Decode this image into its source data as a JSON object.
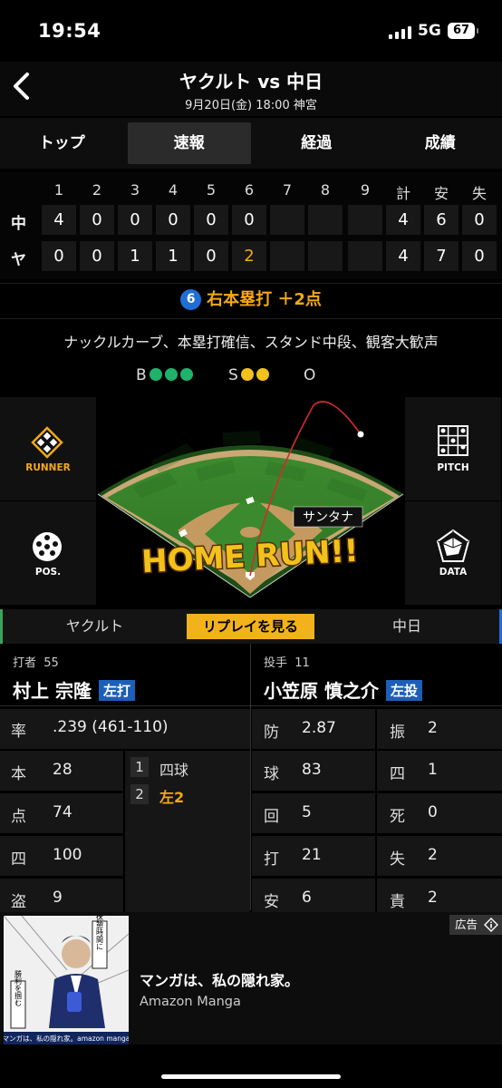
{
  "status": {
    "time": "19:54",
    "network": "5G",
    "battery": "67"
  },
  "header": {
    "title": "ヤクルト vs 中日",
    "subtitle": "9月20日(金) 18:00 神宮"
  },
  "tabs": [
    "トップ",
    "速報",
    "経過",
    "成績"
  ],
  "scoreboard": {
    "innings": [
      "1",
      "2",
      "3",
      "4",
      "5",
      "6",
      "7",
      "8",
      "9"
    ],
    "totals_headers": [
      "計",
      "安",
      "失"
    ],
    "rows": [
      {
        "team": "中",
        "scores": [
          "4",
          "0",
          "0",
          "0",
          "0",
          "0",
          "",
          "",
          ""
        ],
        "totals": [
          "4",
          "6",
          "0"
        ]
      },
      {
        "team": "ヤ",
        "scores": [
          "0",
          "0",
          "1",
          "1",
          "0",
          "2",
          "",
          "",
          ""
        ],
        "totals": [
          "4",
          "7",
          "0"
        ]
      }
    ]
  },
  "play": {
    "number": "6",
    "text": "右本塁打 ＋2点",
    "description": "ナックルカーブ、本塁打確信、スタンド中段、観客大歓声"
  },
  "count": {
    "b_label": "B",
    "s_label": "S",
    "o_label": "O"
  },
  "side_buttons": {
    "runner": "RUNNER",
    "pitch": "PITCH",
    "pos": "POS.",
    "data": "DATA"
  },
  "field": {
    "fielder_name": "サンタナ",
    "banner": "HOME RUN!!"
  },
  "replay": {
    "left_team": "ヤクルト",
    "button": "リプレイを見る",
    "right_team": "中日"
  },
  "batter": {
    "role": "打者",
    "number": "55",
    "name": "村上 宗隆",
    "hand": "左打",
    "avg_label": "率",
    "avg_value": ".239 (461-110)",
    "stats": [
      {
        "label": "本",
        "value": "28"
      },
      {
        "label": "点",
        "value": "74"
      },
      {
        "label": "四",
        "value": "100"
      },
      {
        "label": "盗",
        "value": "9"
      }
    ],
    "at_bats": [
      {
        "num": "1",
        "result": "四球"
      },
      {
        "num": "2",
        "result": "左2"
      }
    ]
  },
  "pitcher": {
    "role": "投手",
    "number": "11",
    "name": "小笠原 慎之介",
    "hand": "左投",
    "stats": [
      {
        "label": "防",
        "value": "2.87",
        "label2": "振",
        "value2": "2"
      },
      {
        "label": "球",
        "value": "83",
        "label2": "四",
        "value2": "1"
      },
      {
        "label": "回",
        "value": "5",
        "label2": "死",
        "value2": "0"
      },
      {
        "label": "打",
        "value": "21",
        "label2": "失",
        "value2": "2"
      },
      {
        "label": "安",
        "value": "6",
        "label2": "責",
        "value2": "2"
      }
    ]
  },
  "ad": {
    "tag": "広告",
    "title": "マンガは、私の隠れ家。",
    "subtitle": "Amazon Manga",
    "img_caption": "マンガは、私の隠れ家。amazon manga",
    "bubble1": "休憩時間に",
    "bubble2": "勝利を掴む"
  },
  "colors": {
    "orange": "#f2a918",
    "green": "#1fb26b",
    "yellow": "#f2c21b",
    "blue": "#1d6fd6"
  }
}
